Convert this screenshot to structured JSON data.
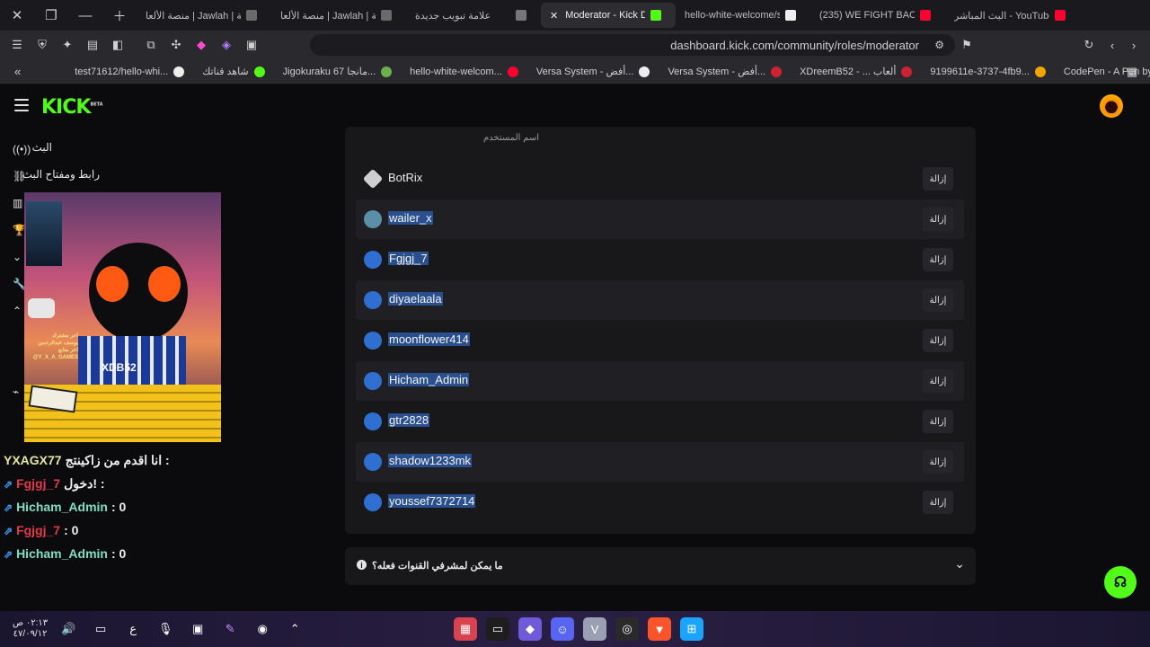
{
  "browser": {
    "tabs": [
      {
        "label": "منصة الألعا | Jawlah | جولة",
        "color": "#6a6a6a"
      },
      {
        "label": "منصة الألعا | Jawlah | جولة",
        "color": "#6a6a6a"
      },
      {
        "label": "علامة تبويب جديدة",
        "color": "#777777"
      },
      {
        "label": "Moderator - Kick Dash",
        "color": "#53fc18",
        "active": true
      },
      {
        "label": "hello-white-welcome/src/",
        "color": "#eeeeee"
      },
      {
        "label": "(235) WE FIGHT BACK - Yo",
        "color": "#ff0033"
      },
      {
        "label": "البث المباشر - YouTube Studio",
        "color": "#ff0033"
      }
    ],
    "url": "dashboard.kick.com/community/roles/moderator",
    "bookmarks": [
      {
        "label": "test71612/hello-whi...",
        "color": "#eeeeee"
      },
      {
        "label": "شاهد قناتك",
        "color": "#53fc18"
      },
      {
        "label": "Jigokuraku 67 مانجا...",
        "color": "#6ab04c"
      },
      {
        "label": "hello-white-welcom...",
        "color": "#ff0033"
      },
      {
        "label": "Versa System - أفض...",
        "color": "#eeeeee"
      },
      {
        "label": "Versa System - أفض...",
        "color": "#cc2233"
      },
      {
        "label": "XDreemB52 - ... ألعاب",
        "color": "#cc2233"
      },
      {
        "label": "9199611e-3737-4fb9...",
        "color": "#f0a500"
      },
      {
        "label": "CodePen - A Pen by...",
        "color": "#ff7a00"
      }
    ]
  },
  "header": {
    "logo": "KICK",
    "logo_beta": "BETA"
  },
  "sidebar": {
    "items": [
      {
        "label": "البث",
        "icon": "broadcast-icon"
      },
      {
        "label": "رابط ومفتاح البث",
        "icon": "link-icon"
      }
    ]
  },
  "overlay": {
    "lines": [
      "اخر مشترك",
      "يوسف عبدالرحمن",
      "اخر متابع",
      "@Y_X_A_GAMES"
    ],
    "badge": "XDB52"
  },
  "chat": [
    {
      "user": "YXAGX77",
      "text": "انا اقدم من زاكينتج :",
      "color": "#e6e6a0"
    },
    {
      "user": "Fgjgj_7",
      "text": "دخول! :",
      "color": "#e23a4a"
    },
    {
      "user": "Hicham_Admin",
      "text": ": 0",
      "color": "#7fe0c0"
    },
    {
      "user": "Fgjgj_7",
      "text": ": 0",
      "color": "#e23a4a"
    },
    {
      "user": "Hicham_Admin",
      "text": ": 0",
      "color": "#7fe0c0"
    }
  ],
  "moderators": {
    "column_header": "اسم المستخدم",
    "remove_label": "إزالة",
    "rows": [
      {
        "name": "BotRix",
        "avatar": "#cfcfcf",
        "selected": false
      },
      {
        "name": "wailer_x",
        "avatar": "#5b8fa8",
        "selected": true
      },
      {
        "name": "Fgjgj_7",
        "avatar": "#2f6fd1",
        "selected": true
      },
      {
        "name": "diyaelaala",
        "avatar": "#2f6fd1",
        "selected": true
      },
      {
        "name": "moonflower414",
        "avatar": "#2f6fd1",
        "selected": true
      },
      {
        "name": "Hicham_Admin",
        "avatar": "#2f6fd1",
        "selected": true
      },
      {
        "name": "gtr2828",
        "avatar": "#2f6fd1",
        "selected": true
      },
      {
        "name": "shadow1233mk",
        "avatar": "#2f6fd1",
        "selected": true
      },
      {
        "name": "youssef7372714",
        "avatar": "#2f6fd1",
        "selected": true
      }
    ]
  },
  "faq": {
    "question": "ما يمكن لمشرفي القنوات فعله؟"
  },
  "taskbar": {
    "time": "٠٢:١٣ ص",
    "date": "٤٧/٠٩/١٢",
    "lang": "ع"
  },
  "colors": {
    "accent": "#53fc18",
    "selection": "#2a4f8f"
  }
}
